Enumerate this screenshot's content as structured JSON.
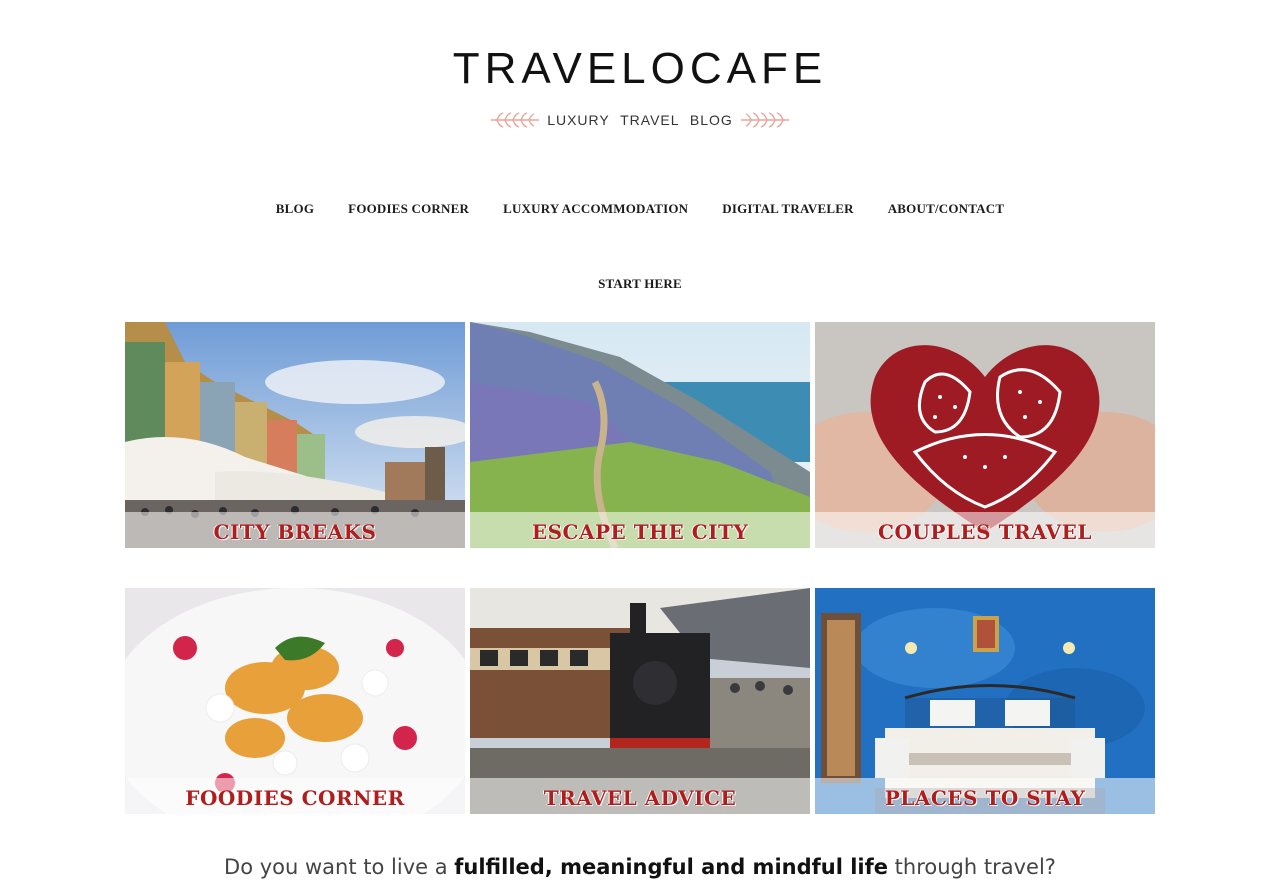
{
  "brand": {
    "logo": "TRAVELOCAFE",
    "tagline": "LUXURY TRAVEL BLOG",
    "accent_color": "#e8a598"
  },
  "nav": {
    "items": [
      "BLOG",
      "FOODIES CORNER",
      "LUXURY ACCOMMODATION",
      "DIGITAL TRAVELER",
      "ABOUT/CONTACT"
    ],
    "second_row": [
      "START HERE"
    ]
  },
  "tiles": [
    {
      "label": "CITY BREAKS",
      "image": "old-town-square-photo"
    },
    {
      "label": "ESCAPE THE CITY",
      "image": "coastal-bluebell-path-photo"
    },
    {
      "label": "COUPLES TRAVEL",
      "image": "heart-gingerbread-photo"
    },
    {
      "label": "FOODIES CORNER",
      "image": "peach-dessert-photo"
    },
    {
      "label": "TRAVEL ADVICE",
      "image": "steam-train-station-photo"
    },
    {
      "label": "PLACES TO STAY",
      "image": "blue-hotel-room-photo"
    }
  ],
  "label_color": "#b01d1d",
  "intro": {
    "before": "Do you want to live a ",
    "bold": "fulfilled, meaningful and mindful life",
    "after": " through travel?"
  }
}
